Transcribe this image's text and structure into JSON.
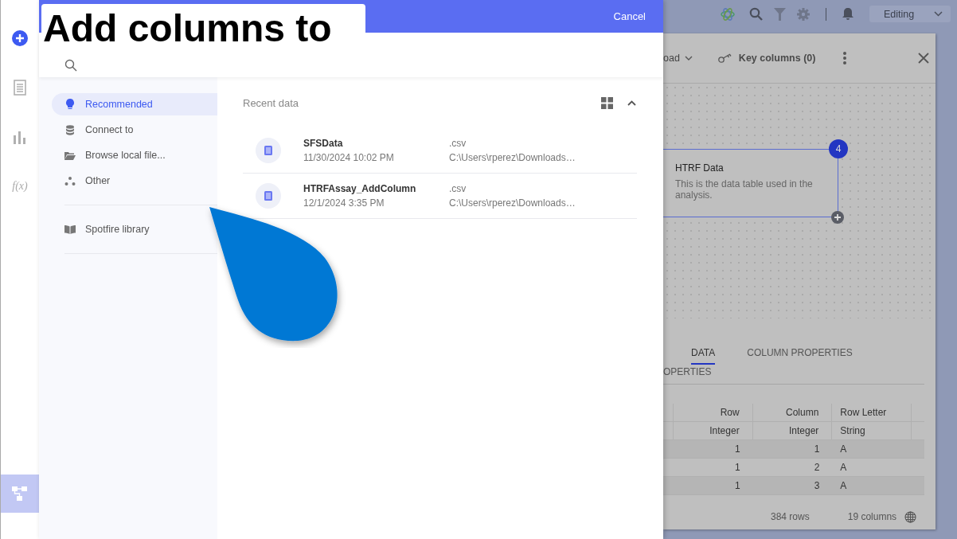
{
  "caption": "Add columns to",
  "rail": [
    {
      "kind": "add",
      "selected": false
    },
    {
      "kind": "page",
      "selected": false
    },
    {
      "kind": "chart",
      "selected": false
    },
    {
      "kind": "function",
      "label": "f(x)",
      "selected": false
    },
    {
      "kind": "flow",
      "selected": true
    }
  ],
  "dialog": {
    "cancel": "Cancel",
    "nav": [
      {
        "label": "Recommended",
        "selected": true
      },
      {
        "label": "Connect to",
        "selected": false
      },
      {
        "label": "Browse local file...",
        "selected": false
      },
      {
        "label": "Other",
        "selected": false
      }
    ],
    "library": {
      "label": "Spotfire library"
    },
    "recent": {
      "title": "Recent data",
      "items": [
        {
          "name": "SFSData",
          "date": "11/30/2024 10:02 PM",
          "type": ".csv",
          "path": "C:\\Users\\rperez\\Downloads…"
        },
        {
          "name": "HTRFAssay_AddColumn",
          "date": "12/1/2024 3:35 PM",
          "type": ".csv",
          "path": "C:\\Users\\rperez\\Downloads…"
        }
      ]
    }
  },
  "background": {
    "mode": "Editing",
    "toolbar": [
      "oad",
      "Key columns (0)"
    ],
    "node": {
      "title": "HTRF Data",
      "description": "This is the data table used in the analysis.",
      "badge": "4"
    },
    "tabs": [
      {
        "label": "DATA",
        "selected": true
      },
      {
        "label": "COLUMN PROPERTIES",
        "selected": false
      }
    ],
    "subtab": "OPERTIES",
    "table": {
      "columns": [
        {
          "name": "Row",
          "type": "Integer"
        },
        {
          "name": "Column",
          "type": "Integer"
        },
        {
          "name": "Row Letter",
          "type": "String"
        }
      ],
      "rows": [
        [
          "1",
          "1",
          "A"
        ],
        [
          "1",
          "2",
          "A"
        ],
        [
          "1",
          "3",
          "A"
        ]
      ]
    },
    "footer": {
      "rows": "384 rows",
      "columns": "19 columns"
    }
  }
}
